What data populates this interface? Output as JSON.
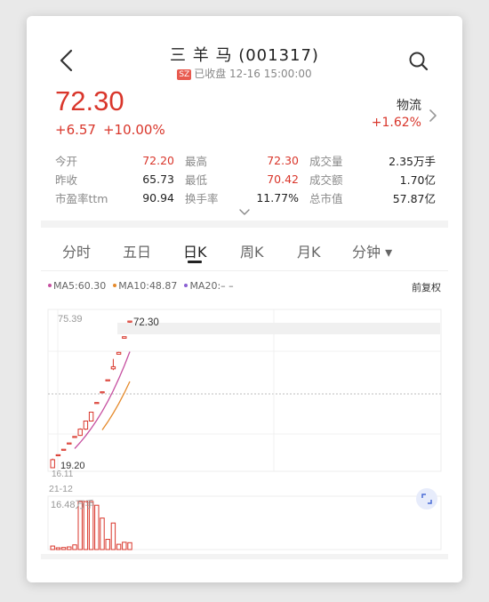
{
  "header": {
    "title": "三 羊 马 (001317)",
    "exchange_badge": "SZ",
    "status": "已收盘 12-16 15:00:00",
    "back_icon": "chevron-left-icon",
    "search_icon": "search-icon"
  },
  "quote": {
    "price": "72.30",
    "change": "+6.57",
    "change_pct": "+10.00%"
  },
  "sector": {
    "name": "物流",
    "change_pct": "+1.62%"
  },
  "stats": [
    {
      "l1": "今开",
      "v1": "72.20",
      "v1_red": true,
      "l2": "最高",
      "v2": "72.30",
      "v2_red": true,
      "l3": "成交量",
      "v3": "2.35万手"
    },
    {
      "l1": "昨收",
      "v1": "65.73",
      "v1_red": false,
      "l2": "最低",
      "v2": "70.42",
      "v2_red": true,
      "l3": "成交额",
      "v3": "1.70亿"
    },
    {
      "l1": "市盈率ttm",
      "v1": "90.94",
      "v1_red": false,
      "l2": "换手率",
      "v2": "11.77%",
      "v2_red": false,
      "l3": "总市值",
      "v3": "57.87亿"
    }
  ],
  "tabs": [
    {
      "label": "分时",
      "active": false
    },
    {
      "label": "五日",
      "active": false
    },
    {
      "label": "日K",
      "active": true
    },
    {
      "label": "周K",
      "active": false
    },
    {
      "label": "月K",
      "active": false
    },
    {
      "label": "分钟 ▾",
      "active": false
    }
  ],
  "ma_legend": {
    "ma5": "MA5:60.30",
    "ma10": "MA10:48.87",
    "ma20": "MA20:– –"
  },
  "adjust_label": "前复权",
  "colors": {
    "up": "#d9362b",
    "ma5": "#c64fa0",
    "ma10": "#e58a2b",
    "ma20": "#8a5fd2",
    "text": "#222222",
    "muted": "#8a8a8a"
  },
  "chart_labels": {
    "top_price": "75.39",
    "last_price": "72.30",
    "low_marker": "19.20",
    "bottom_price": "16.11",
    "date": "21-12",
    "volume_max": "16.48万手"
  },
  "chart_data": {
    "type": "candlestick",
    "ylim": [
      16.11,
      75.39
    ],
    "candles": [
      {
        "o": 16.11,
        "c": 19.2,
        "h": 19.6,
        "l": 16.11
      },
      {
        "o": 21.1,
        "c": 21.1,
        "h": 21.1,
        "l": 21.1
      },
      {
        "o": 23.2,
        "c": 23.2,
        "h": 23.2,
        "l": 23.2
      },
      {
        "o": 25.6,
        "c": 25.6,
        "h": 25.6,
        "l": 25.6
      },
      {
        "o": 28.1,
        "c": 28.1,
        "h": 28.1,
        "l": 28.1
      },
      {
        "o": 28.5,
        "c": 30.9,
        "h": 31.2,
        "l": 28.3
      },
      {
        "o": 30.9,
        "c": 34.0,
        "h": 34.0,
        "l": 30.6
      },
      {
        "o": 34.0,
        "c": 37.4,
        "h": 37.4,
        "l": 33.8
      },
      {
        "o": 41.1,
        "c": 41.1,
        "h": 41.1,
        "l": 41.1
      },
      {
        "o": 45.2,
        "c": 45.2,
        "h": 45.2,
        "l": 45.2
      },
      {
        "o": 49.8,
        "c": 49.8,
        "h": 49.8,
        "l": 49.8
      },
      {
        "o": 54.0,
        "c": 54.8,
        "h": 57.8,
        "l": 53.5
      },
      {
        "o": 59.6,
        "c": 60.3,
        "h": 60.5,
        "l": 59.6
      },
      {
        "o": 66.3,
        "c": 65.73,
        "h": 66.3,
        "l": 65.73
      },
      {
        "o": 72.2,
        "c": 72.3,
        "h": 72.3,
        "l": 70.42
      }
    ],
    "volume": [
      1.2,
      0.6,
      0.7,
      0.9,
      1.6,
      16.48,
      16.48,
      16.48,
      15.2,
      10.8,
      3.5,
      9.1,
      1.8,
      2.5,
      2.35
    ],
    "volume_unit": "万手",
    "ma5_start_index": 4,
    "ma10_start_index": 9
  }
}
